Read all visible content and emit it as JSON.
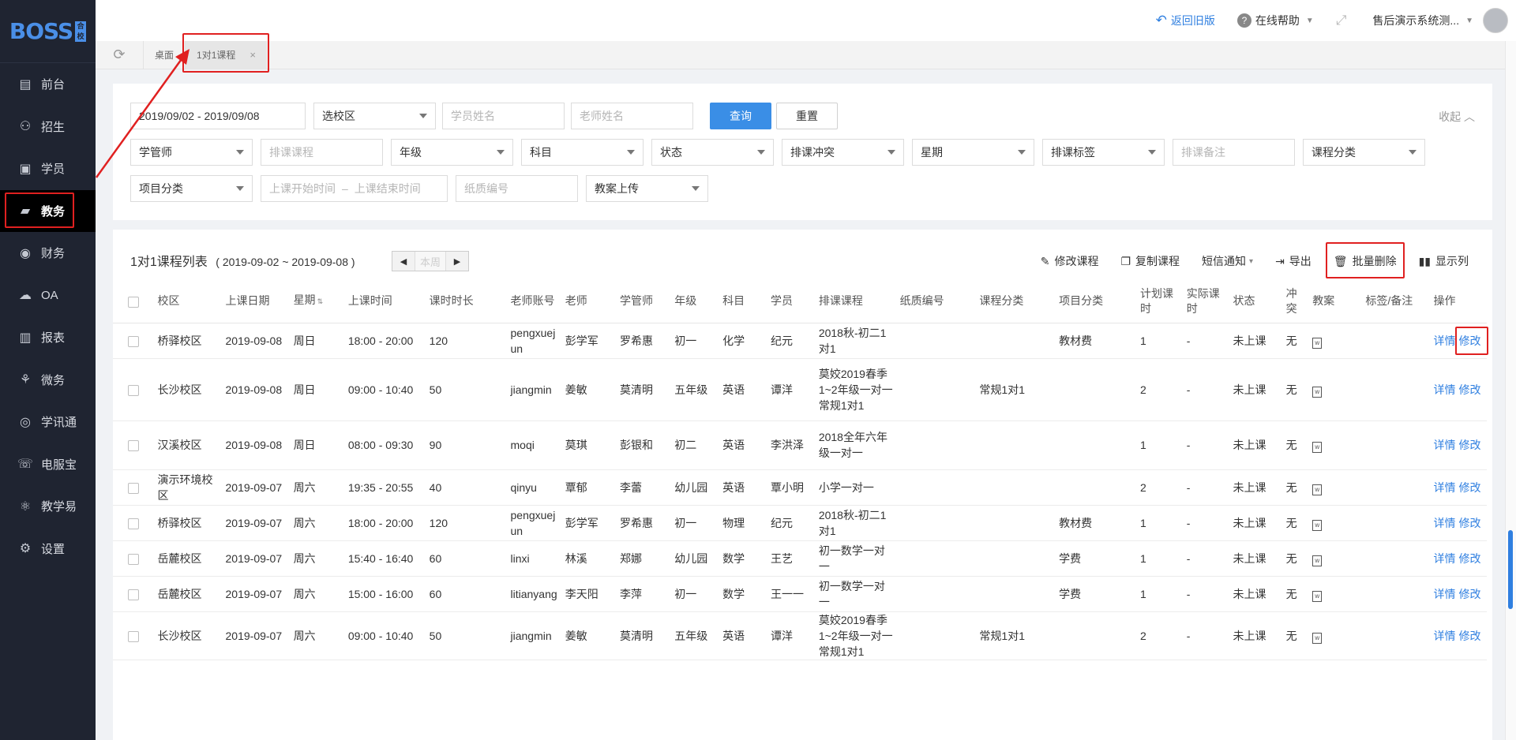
{
  "app": {
    "logo": "BOSS",
    "logo_badge": "合 校"
  },
  "sidebar": {
    "items": [
      {
        "label": "前台",
        "icon": "calendar-icon"
      },
      {
        "label": "招生",
        "icon": "user-add-icon"
      },
      {
        "label": "学员",
        "icon": "id-card-icon"
      },
      {
        "label": "教务",
        "icon": "book-icon",
        "active": true
      },
      {
        "label": "财务",
        "icon": "money-icon"
      },
      {
        "label": "OA",
        "icon": "cloud-icon"
      },
      {
        "label": "报表",
        "icon": "bar-chart-icon"
      },
      {
        "label": "微务",
        "icon": "wechat-icon"
      },
      {
        "label": "学讯通",
        "icon": "location-icon"
      },
      {
        "label": "电服宝",
        "icon": "phone-icon"
      },
      {
        "label": "教学易",
        "icon": "teach-icon"
      },
      {
        "label": "设置",
        "icon": "gear-icon"
      }
    ]
  },
  "topbar": {
    "back_label": "返回旧版",
    "help_label": "在线帮助",
    "user_label": "售后演示系统测..."
  },
  "tabs": [
    {
      "label": "桌面"
    },
    {
      "label": "1对1课程",
      "close": "×"
    }
  ],
  "filters": {
    "date_range": "2019/09/02 - 2019/09/08",
    "campus": "选校区",
    "student_name": "学员姓名",
    "teacher_name": "老师姓名",
    "query": "查询",
    "reset": "重置",
    "collapse": "收起",
    "manager": "学管师",
    "course": "排课课程",
    "grade": "年级",
    "subject": "科目",
    "status": "状态",
    "conflict": "排课冲突",
    "weekday": "星期",
    "tag": "排课标签",
    "remark": "排课备注",
    "course_category": "课程分类",
    "project_category": "项目分类",
    "start_time": "上课开始时间",
    "time_sep": "–",
    "end_time": "上课结束时间",
    "paper_no": "纸质编号",
    "plan_upload": "教案上传"
  },
  "panel": {
    "title": "1对1课程列表",
    "range": "( 2019-09-02 ~ 2019-09-08 )",
    "prev": "◀",
    "this_week": "本周",
    "next": "▶",
    "actions": {
      "edit": "修改课程",
      "copy": "复制课程",
      "sms": "短信通知",
      "export": "导出",
      "batch_delete": "批量删除",
      "columns": "显示列"
    }
  },
  "table": {
    "headers": [
      "校区",
      "上课日期",
      "星期",
      "上课时间",
      "课时时长",
      "老师账号",
      "老师",
      "学管师",
      "年级",
      "科目",
      "学员",
      "排课课程",
      "纸质编号",
      "课程分类",
      "项目分类",
      "计划课时",
      "实际课时",
      "状态",
      "冲突",
      "教案",
      "标签/备注",
      "操作"
    ],
    "detail_label": "详情",
    "edit_label": "修改",
    "rows": [
      {
        "campus": "桥驿校区",
        "date": "2019-09-08",
        "weekday": "周日",
        "time": "18:00 - 20:00",
        "duration": "120",
        "account": "pengxuejun",
        "teacher": "彭学军",
        "manager": "罗希惠",
        "grade": "初一",
        "subject": "化学",
        "student": "纪元",
        "course": "2018秋-初二1对1",
        "paper": "",
        "course_cat": "",
        "project_cat": "教材费",
        "plan": "1",
        "actual": "-",
        "status": "未上课",
        "conflict": "无"
      },
      {
        "campus": "长沙校区",
        "date": "2019-09-08",
        "weekday": "周日",
        "time": "09:00 - 10:40",
        "duration": "50",
        "account": "jiangmin",
        "teacher": "姜敏",
        "manager": "莫清明",
        "grade": "五年级",
        "subject": "英语",
        "student": "谭洋",
        "course": "莫姣2019春季1~2年级一对一常规1对1",
        "paper": "",
        "course_cat": "常规1对1",
        "project_cat": "",
        "plan": "2",
        "actual": "-",
        "status": "未上课",
        "conflict": "无"
      },
      {
        "campus": "汉溪校区",
        "date": "2019-09-08",
        "weekday": "周日",
        "time": "08:00 - 09:30",
        "duration": "90",
        "account": "moqi",
        "teacher": "莫琪",
        "manager": "彭银和",
        "grade": "初二",
        "subject": "英语",
        "student": "李洪泽",
        "course": "2018全年六年级一对一",
        "paper": "",
        "course_cat": "",
        "project_cat": "",
        "plan": "1",
        "actual": "-",
        "status": "未上课",
        "conflict": "无"
      },
      {
        "campus": "演示环境校区",
        "date": "2019-09-07",
        "weekday": "周六",
        "time": "19:35 - 20:55",
        "duration": "40",
        "account": "qinyu",
        "teacher": "覃郁",
        "manager": "李蕾",
        "grade": "幼儿园",
        "subject": "英语",
        "student": "覃小明",
        "course": "小学一对一",
        "paper": "",
        "course_cat": "",
        "project_cat": "",
        "plan": "2",
        "actual": "-",
        "status": "未上课",
        "conflict": "无"
      },
      {
        "campus": "桥驿校区",
        "date": "2019-09-07",
        "weekday": "周六",
        "time": "18:00 - 20:00",
        "duration": "120",
        "account": "pengxuejun",
        "teacher": "彭学军",
        "manager": "罗希惠",
        "grade": "初一",
        "subject": "物理",
        "student": "纪元",
        "course": "2018秋-初二1对1",
        "paper": "",
        "course_cat": "",
        "project_cat": "教材费",
        "plan": "1",
        "actual": "-",
        "status": "未上课",
        "conflict": "无"
      },
      {
        "campus": "岳麓校区",
        "date": "2019-09-07",
        "weekday": "周六",
        "time": "15:40 - 16:40",
        "duration": "60",
        "account": "linxi",
        "teacher": "林溪",
        "manager": "郑娜",
        "grade": "幼儿园",
        "subject": "数学",
        "student": "王艺",
        "course": "初一数学一对一",
        "paper": "",
        "course_cat": "",
        "project_cat": "学费",
        "plan": "1",
        "actual": "-",
        "status": "未上课",
        "conflict": "无"
      },
      {
        "campus": "岳麓校区",
        "date": "2019-09-07",
        "weekday": "周六",
        "time": "15:00 - 16:00",
        "duration": "60",
        "account": "litianyang",
        "teacher": "李天阳",
        "manager": "李萍",
        "grade": "初一",
        "subject": "数学",
        "student": "王一一",
        "course": "初一数学一对一",
        "paper": "",
        "course_cat": "",
        "project_cat": "学费",
        "plan": "1",
        "actual": "-",
        "status": "未上课",
        "conflict": "无"
      },
      {
        "campus": "长沙校区",
        "date": "2019-09-07",
        "weekday": "周六",
        "time": "09:00 - 10:40",
        "duration": "50",
        "account": "jiangmin",
        "teacher": "姜敏",
        "manager": "莫清明",
        "grade": "五年级",
        "subject": "英语",
        "student": "谭洋",
        "course": "莫姣2019春季1~2年级一对一常规1对1",
        "paper": "",
        "course_cat": "常规1对1",
        "project_cat": "",
        "plan": "2",
        "actual": "-",
        "status": "未上课",
        "conflict": "无"
      }
    ]
  }
}
